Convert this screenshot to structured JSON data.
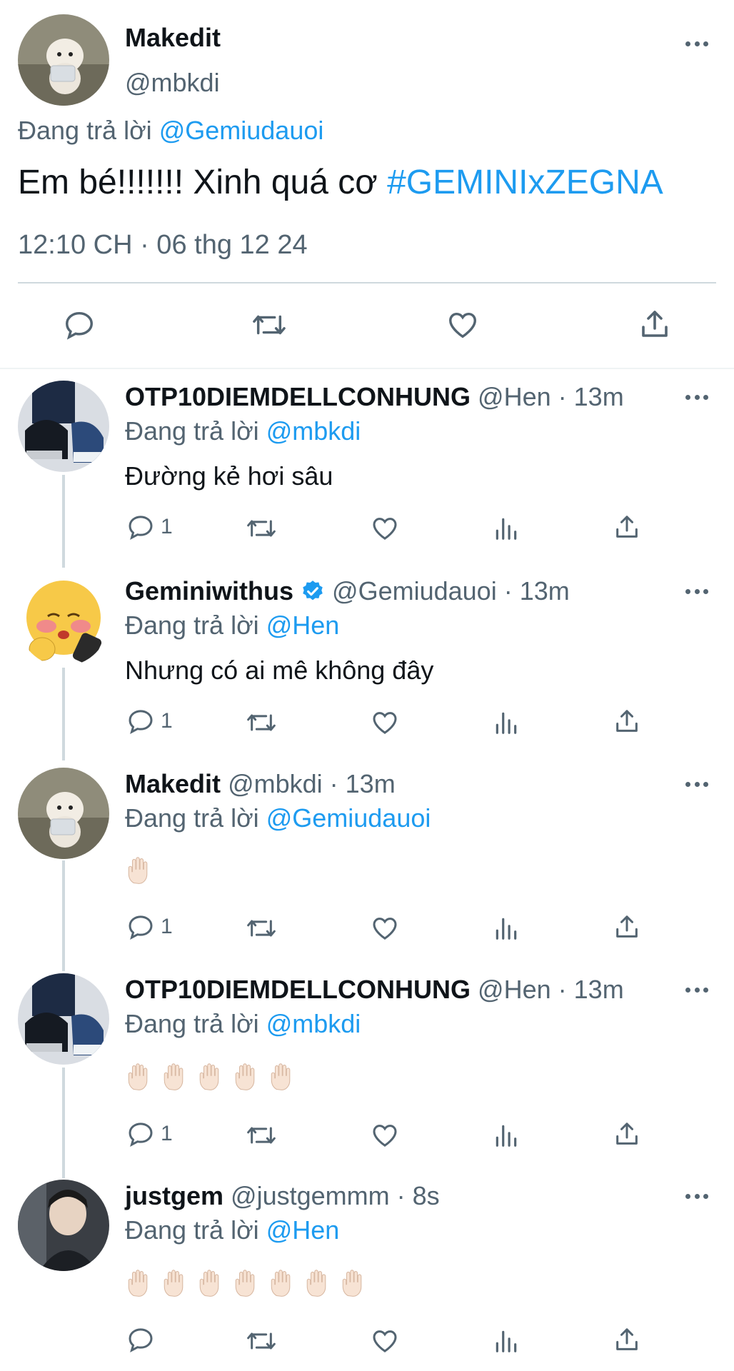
{
  "colors": {
    "link": "#1d9bf0",
    "muted": "#536471",
    "text": "#0f1419",
    "divider": "#cfd9de",
    "verified": "#1d9bf0"
  },
  "main_tweet": {
    "name": "Makedit",
    "handle": "@mbkdi",
    "replying_prefix": "Đang trả lời",
    "replying_to": "@Gemiudauoi",
    "text": "Em bé!!!!!!! Xinh quá cơ",
    "hashtag": "#GEMINIxZEGNA",
    "timestamp": "12:10 CH · 06 thg 12 24",
    "actions": [
      "reply-icon",
      "retweet-icon",
      "like-icon",
      "share-icon"
    ]
  },
  "replies": [
    {
      "name": "OTP10DIEMDELLCONHUNG",
      "handle": "@Hen",
      "time": "· 13m",
      "replying_prefix": "Đang trả lời",
      "replying_to": "@mbkdi",
      "text": "Đường kẻ hơi sâu",
      "reply_count": "1"
    },
    {
      "name": "Geminiwithus",
      "verified": true,
      "handle": "@Gemiudauoi",
      "time": "· 13m",
      "replying_prefix": "Đang trả lời",
      "replying_to": "@Hen",
      "text": "Nhưng có ai mê không đây",
      "reply_count": "1"
    },
    {
      "name": "Makedit",
      "handle": "@mbkdi",
      "time": "· 13m",
      "replying_prefix": "Đang trả lời",
      "replying_to": "@Gemiudauoi",
      "emoji_count": 1,
      "emoji": "raised-hand",
      "reply_count": "1"
    },
    {
      "name": "OTP10DIEMDELLCONHUNG",
      "handle": "@Hen",
      "time": "· 13m",
      "replying_prefix": "Đang trả lời",
      "replying_to": "@mbkdi",
      "emoji_count": 5,
      "emoji": "raised-hand",
      "reply_count": "1"
    },
    {
      "name": "justgem",
      "handle": "@justgemmm",
      "time": "· 8s",
      "replying_prefix": "Đang trả lời",
      "replying_to": "@Hen",
      "emoji_count": 7,
      "emoji": "raised-hand",
      "reply_count": ""
    }
  ]
}
